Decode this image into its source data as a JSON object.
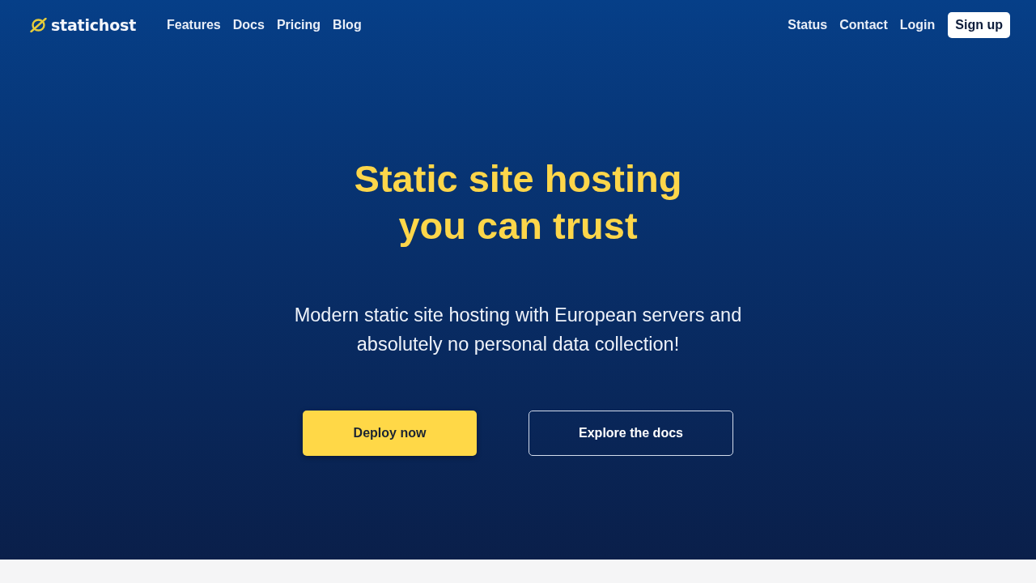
{
  "header": {
    "logo": {
      "text": "statichost"
    },
    "links": [
      {
        "label": "Features"
      },
      {
        "label": "Docs"
      },
      {
        "label": "Pricing"
      },
      {
        "label": "Blog"
      }
    ],
    "right_links": [
      {
        "label": "Status"
      },
      {
        "label": "Contact"
      },
      {
        "label": "Login"
      }
    ],
    "signup_button": {
      "label": "Sign up"
    }
  },
  "hero": {
    "title_lines": [
      "Static site hosting",
      "you can trust"
    ],
    "subtitle_lines": [
      "Modern static site hosting with European servers and",
      "absolutely no personal data collection!"
    ],
    "buttons": [
      {
        "label": "Deploy now",
        "kind": "primary"
      },
      {
        "label": "Explore the docs",
        "kind": "outline"
      }
    ]
  }
}
